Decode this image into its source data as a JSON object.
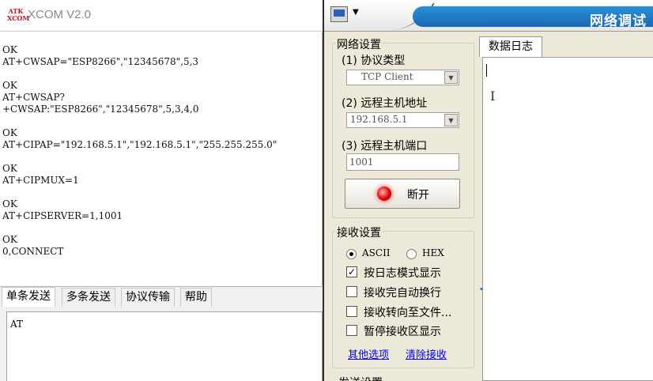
{
  "xcom": {
    "logo_text": "ATK\nXCOM",
    "title": "XCOM V2.0",
    "receive_lines": [
      "OK",
      "AT+CWSAP=\"ESP8266\",\"12345678\",5,3",
      "",
      "OK",
      "AT+CWSAP?",
      "+CWSAP:\"ESP8266\",\"12345678\",5,3,4,0",
      "",
      "OK",
      "AT+CIPAP=\"192.168.5.1\",\"192.168.5.1\",\"255.255.255.0\"",
      "",
      "OK",
      "AT+CIPMUX=1",
      "",
      "OK",
      "AT+CIPSERVER=1,1001",
      "",
      "OK",
      "0,CONNECT"
    ],
    "tabs": [
      {
        "label": "单条发送",
        "active": true
      },
      {
        "label": "多条发送",
        "active": false
      },
      {
        "label": "协议传输",
        "active": false
      },
      {
        "label": "帮助",
        "active": false
      }
    ],
    "send_text": "AT"
  },
  "net": {
    "title": "网络调试",
    "system_menu_arrow": "▼",
    "network_settings": {
      "legend": "网络设置",
      "protocol_label": "(1) 协议类型",
      "protocol_value": "TCP Client",
      "host_label": "(2) 远程主机地址",
      "host_value": "192.168.5.1",
      "port_label": "(3) 远程主机端口",
      "port_value": "1001",
      "disconnect_label": "断开"
    },
    "receive_settings": {
      "legend": "接收设置",
      "ascii_label": "ASCII",
      "hex_label": "HEX",
      "encoding": "ASCII",
      "options": [
        {
          "label": "按日志模式显示",
          "checked": true
        },
        {
          "label": "接收完自动换行",
          "checked": false
        },
        {
          "label": "接收转向至文件...",
          "checked": false
        },
        {
          "label": "暂停接收区显示",
          "checked": false
        }
      ],
      "more_link": "其他选项",
      "clear_link": "清除接收"
    },
    "send_settings_legend": "发送设置",
    "log_tab": "数据日志",
    "icons": {
      "dropdown": "▼",
      "check": "✓",
      "collapse": "<",
      "ibeam": "I"
    }
  }
}
